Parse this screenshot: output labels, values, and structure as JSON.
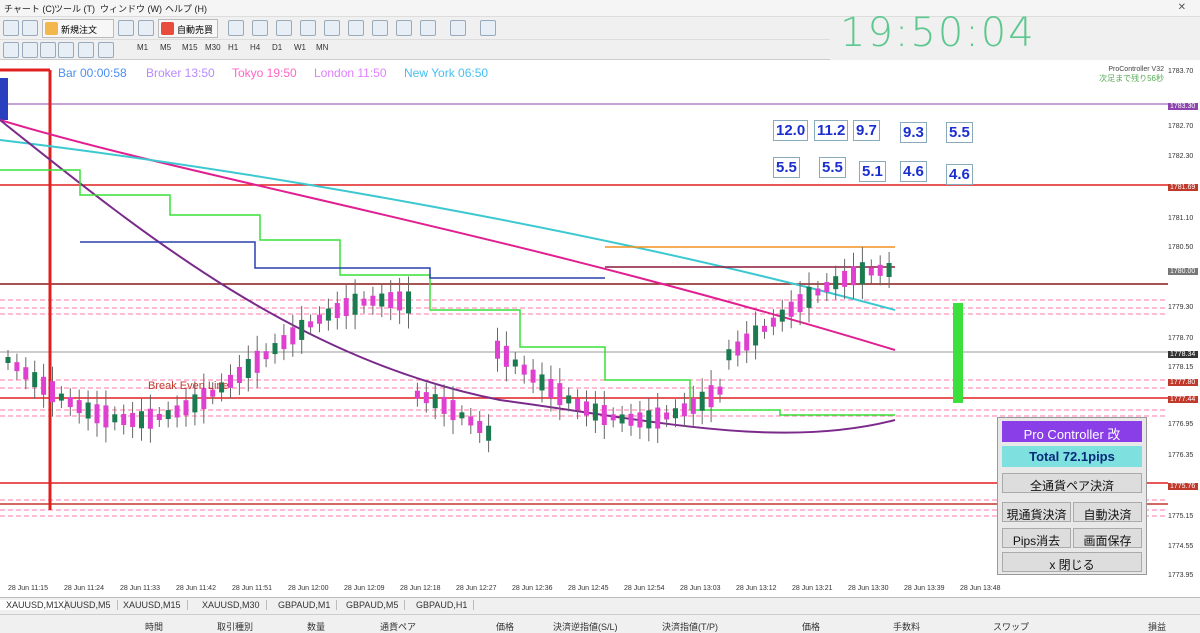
{
  "menu": {
    "chart": "チャート (C)",
    "tools": "ツール (T)",
    "window": "ウィンドウ (W)",
    "help": "ヘルプ (H)"
  },
  "toolbar": {
    "new_order": "新規注文",
    "auto_trade": "自動売買",
    "timeframes": [
      "M1",
      "M5",
      "M15",
      "M30",
      "H1",
      "H4",
      "D1",
      "W1",
      "MN"
    ]
  },
  "clock": "19:50:04",
  "chart": {
    "header": {
      "bar": "Bar 00:00:58",
      "broker": "Broker 13:50",
      "tokyo": "Tokyo 19:50",
      "london": "London 11:50",
      "newyork": "New York 06:50"
    },
    "colors": {
      "bar": "#4b8ef0",
      "broker": "#b78aff",
      "tokyo": "#ff66c4",
      "london": "#e17fff",
      "newyork": "#45c0f0"
    },
    "indicator_label": "ProController V32",
    "indicator_sub": "次足まで残り56秒",
    "pip_values_row1": [
      "12.0",
      "11.2",
      "9.7",
      "9.3",
      "5.5"
    ],
    "pip_values_row2": [
      "5.5",
      "5.5",
      "5.1",
      "4.6",
      "4.6"
    ],
    "break_even_label": "Break Even Line",
    "y_labels": [
      "1783.70",
      "1783.30",
      "1782.70",
      "1782.30",
      "1781.69",
      "1781.10",
      "1780.50",
      "1780.00",
      "1779.30",
      "1778.70",
      "1778.34",
      "1778.15",
      "1777.80",
      "1777.44",
      "1776.95",
      "1776.35",
      "1775.76",
      "1775.15",
      "1774.55",
      "1773.95"
    ],
    "x_labels": [
      "28 Jun 11:15",
      "28 Jun 11:24",
      "28 Jun 11:33",
      "28 Jun 11:42",
      "28 Jun 11:51",
      "28 Jun 12:00",
      "28 Jun 12:09",
      "28 Jun 12:18",
      "28 Jun 12:27",
      "28 Jun 12:36",
      "28 Jun 12:45",
      "28 Jun 12:54",
      "28 Jun 13:03",
      "28 Jun 13:12",
      "28 Jun 13:21",
      "28 Jun 13:30",
      "28 Jun 13:39",
      "28 Jun 13:48"
    ]
  },
  "panel": {
    "title": "Pro Controller 改",
    "total": "Total   72.1pips",
    "close_all_pairs": "全通貨ペア決済",
    "close_current": "現通貨決済",
    "auto_close": "自動決済",
    "clear_pips": "Pips消去",
    "save_screen": "画面保存",
    "close": "x 閉じる"
  },
  "tabs": [
    "XAUUSD,M1",
    "XAUUSD,M5",
    "XAUUSD,M15",
    "XAUUSD,M30",
    "GBPAUD,M1",
    "GBPAUD,M5",
    "GBPAUD,H1"
  ],
  "columns": [
    "時間",
    "取引種別",
    "数量",
    "通貨ペア",
    "価格",
    "決済逆指値(S/L)",
    "決済指値(T/P)",
    "価格",
    "手数料",
    "スワップ",
    "損益"
  ]
}
